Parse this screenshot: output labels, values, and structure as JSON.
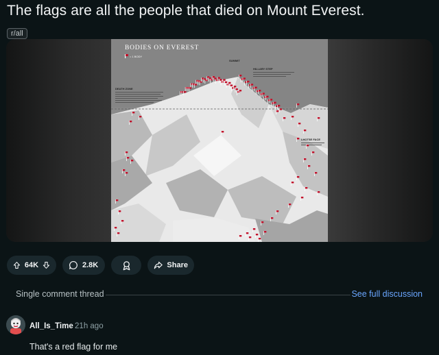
{
  "post": {
    "title": "The flags are all the people that died on Mount Everest.",
    "subreddit": "r/all"
  },
  "image": {
    "poster_title": "BODIES ON EVEREST",
    "legend": "= 1 BODY",
    "labels": {
      "summit": "SUMMIT",
      "hillary_step": "HILLARY STEP",
      "death_zone": "DEATH ZONE",
      "lhotse_face": "LHOTSE FACE"
    },
    "flag_color": "#c2112b"
  },
  "actions": {
    "upvotes": "64K",
    "comments": "2.8K",
    "share": "Share"
  },
  "thread": {
    "label": "Single comment thread",
    "see_full": "See full discussion"
  },
  "comment": {
    "author": "All_Is_Time",
    "time": "· 21h ago",
    "body": "That's a red flag for me"
  },
  "colors": {
    "background": "#0b1416",
    "pill": "#1a282d",
    "link": "#6aa6ff"
  }
}
